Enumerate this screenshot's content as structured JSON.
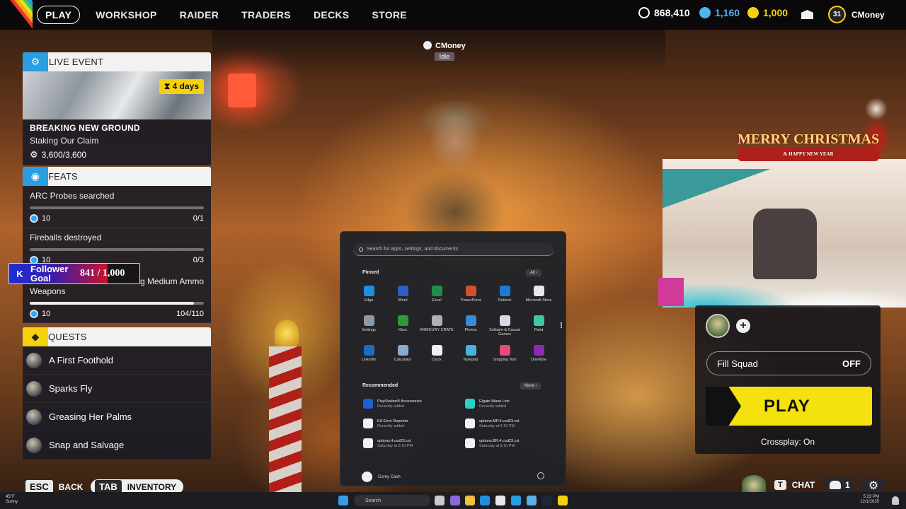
{
  "nav": {
    "tabs": [
      "PLAY",
      "WORKSHOP",
      "RAIDER",
      "TRADERS",
      "DECKS",
      "STORE"
    ]
  },
  "currencies": [
    {
      "value": "868,410",
      "color": "#ffffff"
    },
    {
      "value": "1,160",
      "color": "#4fb3f0"
    },
    {
      "value": "1,000",
      "color": "#f5d10f"
    }
  ],
  "profile": {
    "level": "31",
    "name": "CMoney"
  },
  "player_banner": {
    "name": "CMoney",
    "status": "Idle"
  },
  "live_event": {
    "header": "LIVE EVENT",
    "badge": "⧗ 4 days",
    "title": "BREAKING NEW GROUND",
    "subtitle": "Staking Our Claim",
    "progress": "3,600/3,600"
  },
  "feats": {
    "header": "FEATS",
    "items": [
      {
        "name": "ARC Probes searched",
        "reward": "10",
        "progress": "0/1",
        "fraction": 0
      },
      {
        "name": "Fireballs destroyed",
        "reward": "10",
        "progress": "0/3",
        "fraction": 0
      },
      {
        "name_prefix": "g Medium Ammo",
        "name2": "Weapons",
        "reward": "10",
        "progress": "104/110",
        "fraction": 0.945
      }
    ]
  },
  "follower_goal": {
    "label1": "Follower",
    "label2": "Goal",
    "value": "841 / 1,000",
    "fraction": 0.841
  },
  "quests": {
    "header": "QUESTS",
    "items": [
      "A First Foothold",
      "Sparks Fly",
      "Greasing Her Palms",
      "Snap and Salvage"
    ]
  },
  "hints": {
    "esc_key": "ESC",
    "esc_label": "BACK",
    "tab_key": "TAB",
    "tab_label": "INVENTORY",
    "chat_key": "T",
    "chat_label": "CHAT",
    "friends": "1"
  },
  "start_menu": {
    "search_placeholder": "Search for apps, settings, and documents",
    "pinned_label": "Pinned",
    "all_label": "All  ›",
    "apps": [
      {
        "name": "Edge",
        "color": "#1f8fe0"
      },
      {
        "name": "Word",
        "color": "#2b5fc8"
      },
      {
        "name": "Excel",
        "color": "#1d8f4a"
      },
      {
        "name": "PowerPoint",
        "color": "#d4502a"
      },
      {
        "name": "Outlook",
        "color": "#1c7ad6"
      },
      {
        "name": "Microsoft Store",
        "color": "#e8e8e8"
      },
      {
        "name": "Settings",
        "color": "#8a9aaa"
      },
      {
        "name": "Xbox",
        "color": "#2b9b3a"
      },
      {
        "name": "ARMOURY CRATE",
        "color": "#b0b0b0"
      },
      {
        "name": "Photos",
        "color": "#3a8ad8"
      },
      {
        "name": "Solitaire & Casual Games",
        "color": "#d8d8e8"
      },
      {
        "name": "Paint",
        "color": "#3ac8a8"
      },
      {
        "name": "LinkedIn",
        "color": "#1a6ec0"
      },
      {
        "name": "Calculator",
        "color": "#8aaad0"
      },
      {
        "name": "Clock",
        "color": "#f0f0f0"
      },
      {
        "name": "Notepad",
        "color": "#4ab0e0"
      },
      {
        "name": "Snipping Tool",
        "color": "#e84a7a"
      },
      {
        "name": "OneNote",
        "color": "#8a2bb8"
      }
    ],
    "recommended_label": "Recommended",
    "more_label": "More  ›",
    "recommended": [
      {
        "title": "PlayStation® Accessories",
        "sub": "Recently added",
        "color": "#1f5fcf"
      },
      {
        "title": "Elgato Wave Link",
        "sub": "Recently added",
        "color": "#2ad0c0"
      },
      {
        "title": "EA Error Reporter",
        "sub": "Recently added",
        "color": "#f0f0f0"
      },
      {
        "title": "options.MP.4.cod23.cst",
        "sub": "Saturday at 9:10 PM",
        "color": "#f2f2f2"
      },
      {
        "title": "options.4.cod23.cst",
        "sub": "Saturday at 9:10 PM",
        "color": "#f2f2f2"
      },
      {
        "title": "options.BR.4.cod23.cst",
        "sub": "Saturday at 9:10 PM",
        "color": "#f2f2f2"
      }
    ],
    "user": "Corey Cash"
  },
  "squad": {
    "fill_label": "Fill Squad",
    "fill_value": "OFF",
    "play_label": "PLAY",
    "crossplay": "Crossplay: On"
  },
  "xmas": {
    "title": "MERRY CHRISTMAS",
    "subtitle": "& HAPPY NEW YEAR"
  },
  "taskbar": {
    "temp": "45°F",
    "weather": "Sunny",
    "search": "Search",
    "time": "5:23 PM",
    "date": "12/1/2025"
  }
}
